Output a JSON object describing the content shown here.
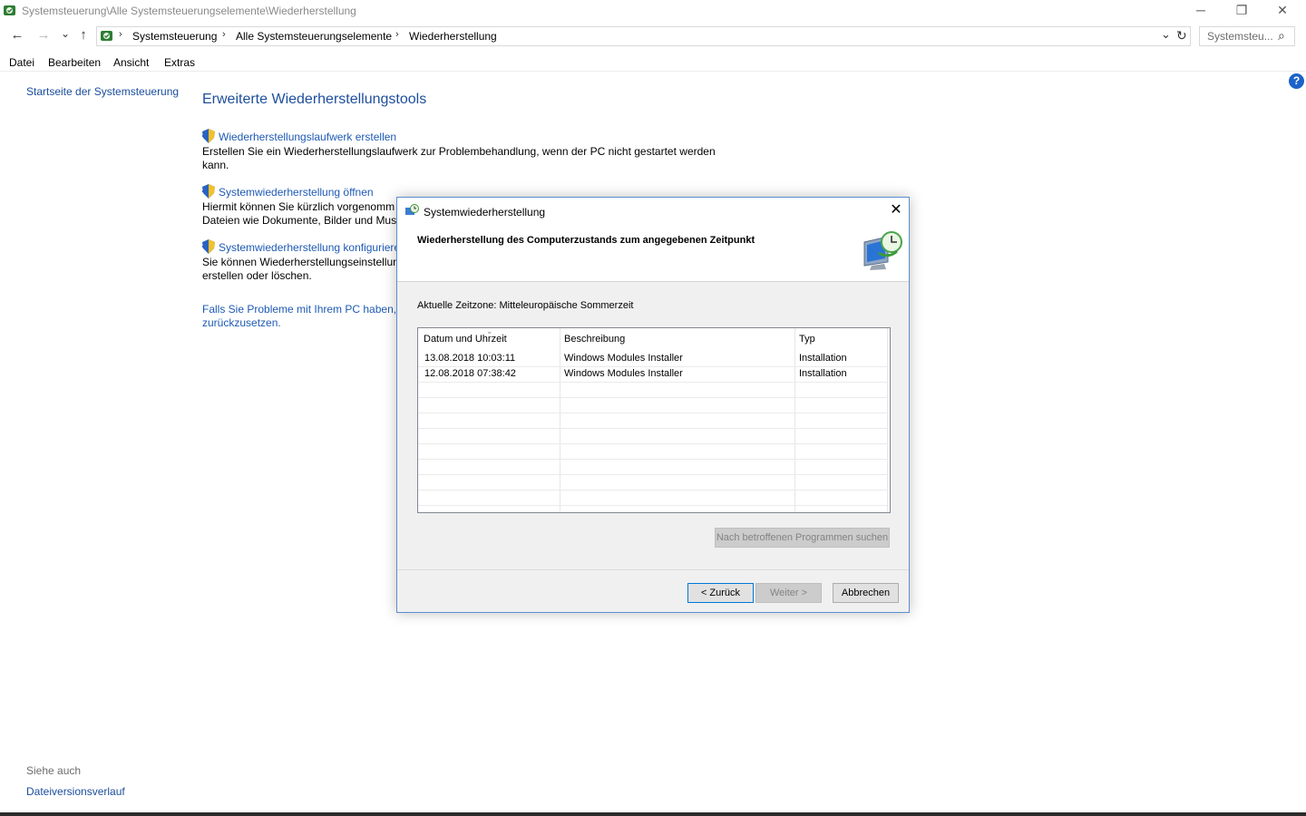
{
  "window": {
    "title": "Systemsteuerung\\Alle Systemsteuerungselemente\\Wiederherstellung",
    "minimize_glyph": "─",
    "restore_glyph": "❐",
    "close_glyph": "✕"
  },
  "nav": {
    "back_glyph": "←",
    "forward_glyph": "→",
    "recent_glyph": "⌄",
    "up_glyph": "↑",
    "breadcrumbs": [
      "Systemsteuerung",
      "Alle Systemsteuerungselemente",
      "Wiederherstellung"
    ],
    "sep_glyph": "›",
    "dropdown_glyph": "⌄",
    "refresh_glyph": "↻",
    "search_placeholder": "Systemsteu...",
    "search_glyph": "⌕"
  },
  "menu": [
    "Datei",
    "Bearbeiten",
    "Ansicht",
    "Extras"
  ],
  "left_pane": {
    "home_link": "Startseite der Systemsteuerung",
    "see_also_label": "Siehe auch",
    "see_also_link": "Dateiversionsverlauf"
  },
  "main": {
    "heading": "Erweiterte Wiederherstellungstools",
    "tasks": [
      {
        "link": "Wiederherstellungslaufwerk erstellen",
        "desc1": "Erstellen Sie ein Wiederherstellungslaufwerk zur Problembehandlung, wenn der PC nicht gestartet werden",
        "desc2": "kann."
      },
      {
        "link": "Systemwiederherstellung öffnen",
        "desc1": "Hiermit können Sie kürzlich vorgenomm",
        "desc2": "Dateien wie Dokumente, Bilder und Musi"
      },
      {
        "link": "Systemwiederherstellung konfigurieren",
        "desc1": "Sie können Wiederherstellungseinstellun",
        "desc2": "erstellen oder löschen."
      }
    ],
    "trouble_line1": "Falls Sie Probleme mit Ihrem PC haben, w",
    "trouble_line2": "zurückzusetzen.",
    "help_glyph": "?"
  },
  "dialog": {
    "title": "Systemwiederherstellung",
    "close_glyph": "✕",
    "heading": "Wiederherstellung des Computerzustands zum angegebenen Zeitpunkt",
    "timezone": "Aktuelle Zeitzone: Mitteleuropäische Sommerzeit",
    "columns": [
      "Datum und Uhrzeit",
      "Beschreibung",
      "Typ"
    ],
    "rows": [
      {
        "date": "13.08.2018 10:03:11",
        "desc": "Windows Modules Installer",
        "type": "Installation"
      },
      {
        "date": "12.08.2018 07:38:42",
        "desc": "Windows Modules Installer",
        "type": "Installation"
      }
    ],
    "scan_button": "Nach betroffenen Programmen suchen",
    "back_button": "< Zurück",
    "next_button": "Weiter >",
    "cancel_button": "Abbrechen"
  }
}
